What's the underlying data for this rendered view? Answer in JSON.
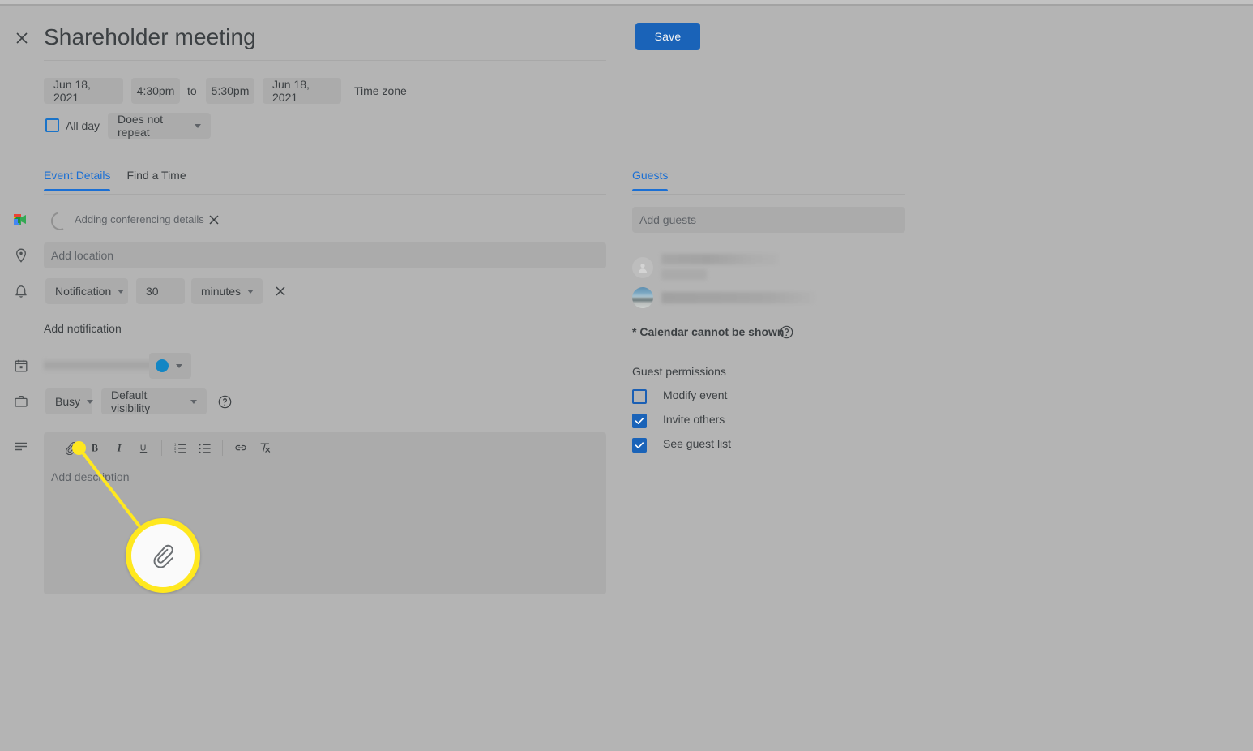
{
  "header": {
    "close_icon": "close-icon",
    "title": "Shareholder meeting",
    "save_label": "Save"
  },
  "schedule": {
    "start_date": "Jun 18, 2021",
    "start_time": "4:30pm",
    "to_label": "to",
    "end_time": "5:30pm",
    "end_date": "Jun 18, 2021",
    "timezone_label": "Time zone",
    "all_day_label": "All day",
    "all_day_checked": false,
    "repeat_value": "Does not repeat"
  },
  "tabs": [
    {
      "label": "Event Details",
      "active": true
    },
    {
      "label": "Find a Time",
      "active": false
    }
  ],
  "conferencing": {
    "icon": "google-meet-icon",
    "status_text": "Adding conferencing details",
    "remove_icon": "close-icon"
  },
  "location": {
    "icon": "location-pin-icon",
    "placeholder": "Add location"
  },
  "notification": {
    "icon": "bell-icon",
    "type": "Notification",
    "value": "30",
    "unit": "minutes",
    "remove_icon": "close-icon",
    "add_label": "Add notification"
  },
  "calendar_owner": {
    "icon": "calendar-icon",
    "color_hex": "#1386c4"
  },
  "availability": {
    "icon": "briefcase-icon",
    "busy_value": "Busy",
    "visibility_value": "Default visibility",
    "help_icon": "help-circle-icon"
  },
  "description": {
    "icon": "description-lines-icon",
    "placeholder": "Add description",
    "toolbar": [
      {
        "name": "attach-file-icon",
        "glyph": "attach"
      },
      {
        "name": "bold-icon",
        "glyph": "B"
      },
      {
        "name": "italic-icon",
        "glyph": "I"
      },
      {
        "name": "underline-icon",
        "glyph": "U"
      },
      {
        "name": "numbered-list-icon",
        "glyph": "ol"
      },
      {
        "name": "bulleted-list-icon",
        "glyph": "ul"
      },
      {
        "name": "insert-link-icon",
        "glyph": "link"
      },
      {
        "name": "remove-formatting-icon",
        "glyph": "clear"
      }
    ]
  },
  "guests": {
    "tab_label": "Guests",
    "add_placeholder": "Add guests",
    "calendar_note": "* Calendar cannot be shown",
    "calendar_note_help_icon": "help-circle-icon",
    "permissions_title": "Guest permissions",
    "permissions": [
      {
        "label": "Modify event",
        "checked": false
      },
      {
        "label": "Invite others",
        "checked": true
      },
      {
        "label": "See guest list",
        "checked": true
      }
    ]
  },
  "callout": {
    "target_icon": "attach-file-icon",
    "highlight_color": "#ffe81f"
  }
}
